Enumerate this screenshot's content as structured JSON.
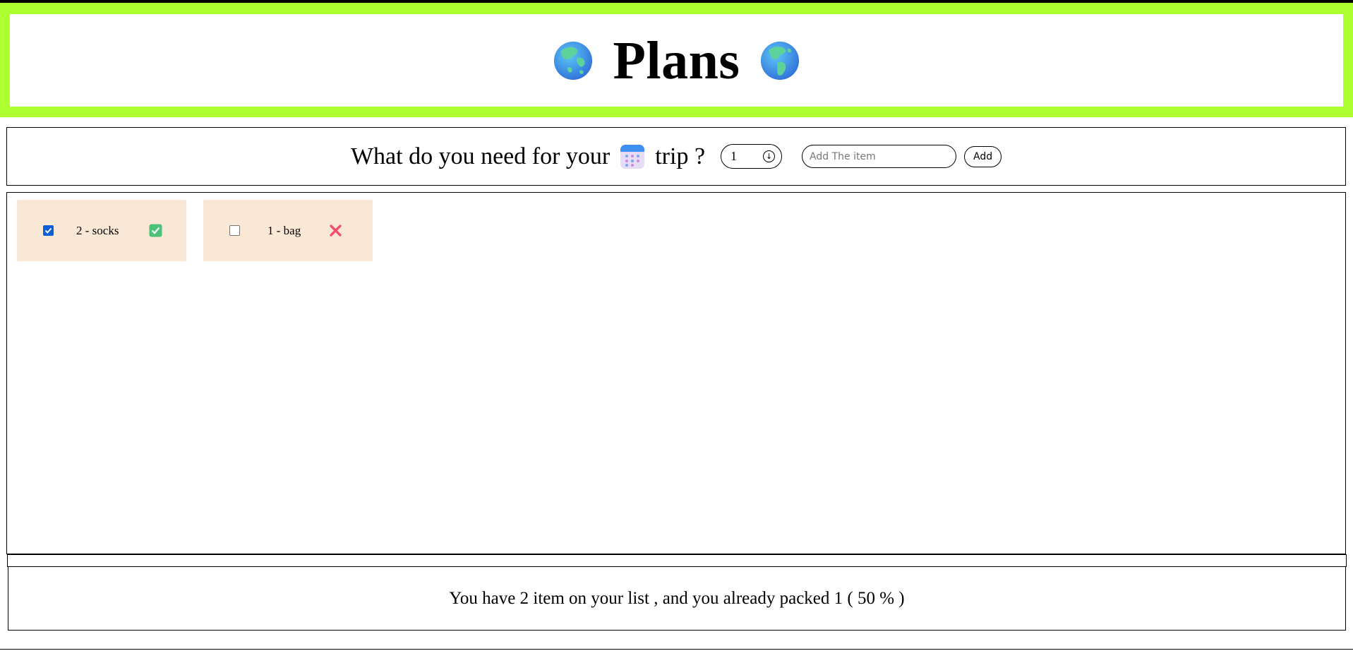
{
  "header": {
    "title": "Plans",
    "left_icon": "globe-asia-icon",
    "right_icon": "globe-americas-icon",
    "accent_color": "#adff2f"
  },
  "form": {
    "question_part1": "What do you need for your",
    "question_icon": "calendar-icon",
    "question_part2": "trip ?",
    "quantity_value": "1",
    "item_placeholder": "Add The item",
    "item_value": "",
    "add_label": "Add"
  },
  "items": [
    {
      "label": "2 - socks",
      "packed": true,
      "status_icon": "check-mark-icon",
      "status_color": "#4cc17a"
    },
    {
      "label": "1 - bag",
      "packed": false,
      "status_icon": "cross-mark-icon",
      "status_color": "#f0506e"
    }
  ],
  "stats": {
    "text": "You have 2 item on your list , and you already packed 1 ( 50 % )",
    "total": 2,
    "packed": 1,
    "percent": 50
  },
  "colors": {
    "card_background": "#fae8d7",
    "checkbox_checked": "#0b5fd6"
  }
}
